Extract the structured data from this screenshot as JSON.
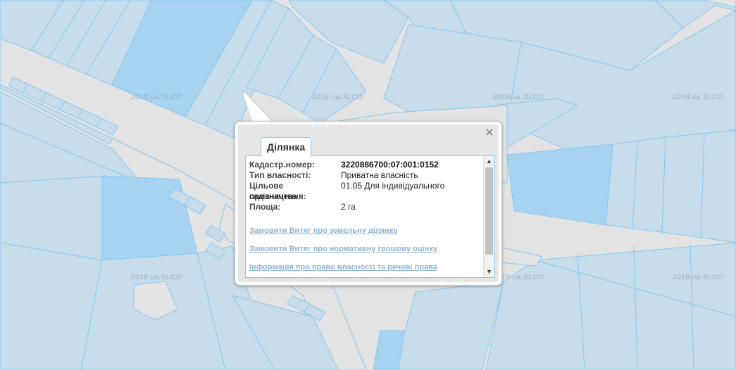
{
  "map": {
    "watermark": "2018.ua.SLCO",
    "colors": {
      "background": "#e3e3e3",
      "parcel": "#c7dcea",
      "parcel_dark": "#a8d4f2",
      "outline": "#86c8f0"
    }
  },
  "popup": {
    "tab_label": "Ділянка",
    "close_icon": "×",
    "fields": [
      {
        "label": "Кадастр.номер:",
        "value": "3220886700:07:001:0152",
        "bold": true
      },
      {
        "label": "Тип власності:",
        "value": "Приватна власність",
        "bold": false
      },
      {
        "label": "Цільове призначення:",
        "value": "01.05 Для індивідуального садівництва",
        "bold": false
      },
      {
        "label": "Площа:",
        "value": "2 га",
        "bold": false
      }
    ],
    "links": [
      "Замовити Витяг про земельну ділянку",
      "Замовити Витяг про нормативну грошову оцінку",
      "Інформація про право власності та речові права"
    ],
    "scroll_up_icon": "▲",
    "scroll_down_icon": "▼"
  }
}
